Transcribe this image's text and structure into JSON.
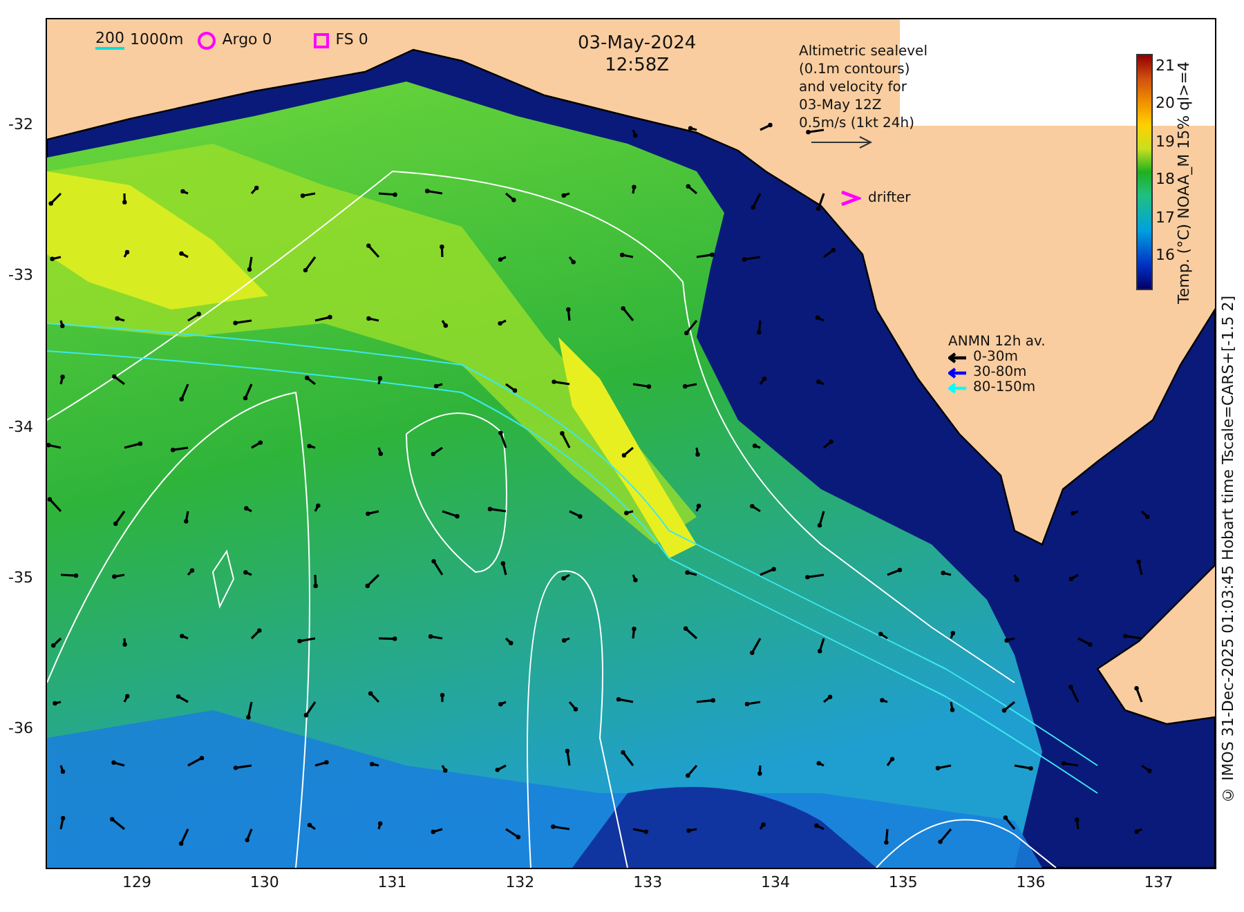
{
  "map": {
    "date": "03-May-2024",
    "time": "12:58Z",
    "depth_legend": {
      "shallow": "200",
      "deep": "1000m"
    },
    "argo": "Argo 0",
    "fs": "FS 0",
    "altimetry_note": [
      "Altimetric sealevel",
      "(0.1m contours)",
      "and velocity for",
      "03-May 12Z",
      "0.5m/s (1kt 24h)"
    ],
    "drifter": "drifter",
    "anmn": {
      "title": "ANMN 12h av.",
      "items": [
        {
          "label": "0-30m",
          "color": "#000000"
        },
        {
          "label": "30-80m",
          "color": "#0000ff"
        },
        {
          "label": "80-150m",
          "color": "#00ffff"
        }
      ]
    },
    "x_ticks": [
      "129",
      "130",
      "131",
      "132",
      "133",
      "134",
      "135",
      "136",
      "137"
    ],
    "y_ticks": [
      "-32",
      "-33",
      "-34",
      "-35",
      "-36"
    ]
  },
  "colorbar": {
    "title": "Temp. (°C) NOAA_M 15% ql>=4",
    "ticks": [
      "21",
      "20",
      "19",
      "18",
      "17",
      "16"
    ]
  },
  "credit": "© IMOS 31-Dec-2025 01:03:45 Hobart time Tscale=CARS+[-1.5 2]"
}
